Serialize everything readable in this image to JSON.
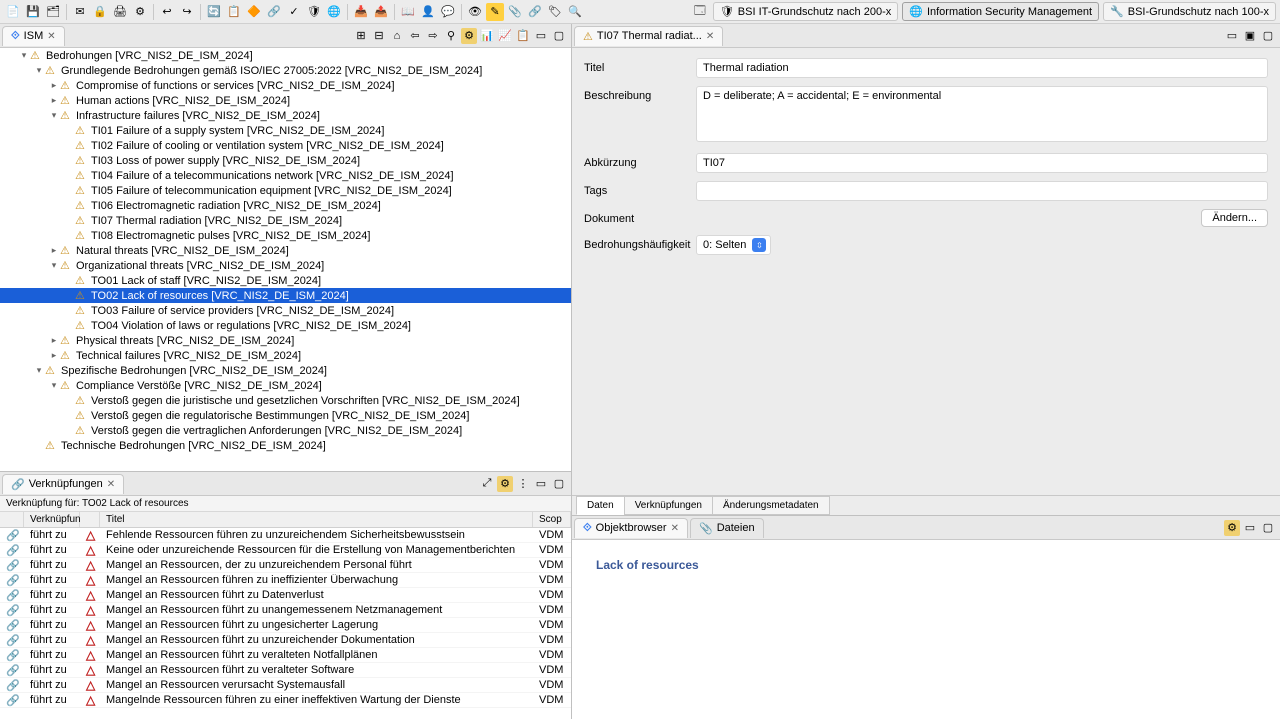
{
  "toolbar": {
    "perspectives": [
      {
        "label": "BSI IT-Grundschutz nach 200-x",
        "shield": "🛡"
      },
      {
        "label": "Information Security Management",
        "icon": "🌐",
        "active": true
      },
      {
        "label": "BSI-Grundschutz nach 100-x",
        "icon": "🔧"
      }
    ]
  },
  "left_tab": {
    "label": "ISM"
  },
  "tree": [
    {
      "level": 0,
      "toggle": "▾",
      "label": "Bedrohungen [VRC_NIS2_DE_ISM_2024]"
    },
    {
      "level": 1,
      "toggle": "▾",
      "label": "Grundlegende Bedrohungen gemäß ISO/IEC 27005:2022 [VRC_NIS2_DE_ISM_2024]"
    },
    {
      "level": 2,
      "toggle": "▸",
      "label": "Compromise of functions or services [VRC_NIS2_DE_ISM_2024]"
    },
    {
      "level": 2,
      "toggle": "▸",
      "label": "Human actions [VRC_NIS2_DE_ISM_2024]"
    },
    {
      "level": 2,
      "toggle": "▾",
      "label": "Infrastructure failures [VRC_NIS2_DE_ISM_2024]"
    },
    {
      "level": 3,
      "toggle": "",
      "label": "TI01 Failure of a supply system [VRC_NIS2_DE_ISM_2024]"
    },
    {
      "level": 3,
      "toggle": "",
      "label": "TI02 Failure of cooling or ventilation system [VRC_NIS2_DE_ISM_2024]"
    },
    {
      "level": 3,
      "toggle": "",
      "label": "TI03 Loss of power supply [VRC_NIS2_DE_ISM_2024]"
    },
    {
      "level": 3,
      "toggle": "",
      "label": "TI04 Failure of a telecommunications network [VRC_NIS2_DE_ISM_2024]"
    },
    {
      "level": 3,
      "toggle": "",
      "label": "TI05 Failure of telecommunication equipment [VRC_NIS2_DE_ISM_2024]"
    },
    {
      "level": 3,
      "toggle": "",
      "label": "TI06 Electromagnetic radiation [VRC_NIS2_DE_ISM_2024]"
    },
    {
      "level": 3,
      "toggle": "",
      "label": "TI07 Thermal radiation [VRC_NIS2_DE_ISM_2024]"
    },
    {
      "level": 3,
      "toggle": "",
      "label": "TI08 Electromagnetic pulses [VRC_NIS2_DE_ISM_2024]"
    },
    {
      "level": 2,
      "toggle": "▸",
      "label": "Natural threats [VRC_NIS2_DE_ISM_2024]"
    },
    {
      "level": 2,
      "toggle": "▾",
      "label": "Organizational threats [VRC_NIS2_DE_ISM_2024]"
    },
    {
      "level": 3,
      "toggle": "",
      "label": "TO01 Lack of staff [VRC_NIS2_DE_ISM_2024]"
    },
    {
      "level": 3,
      "toggle": "",
      "label": "TO02 Lack of resources [VRC_NIS2_DE_ISM_2024]",
      "selected": true
    },
    {
      "level": 3,
      "toggle": "",
      "label": "TO03 Failure of service providers [VRC_NIS2_DE_ISM_2024]"
    },
    {
      "level": 3,
      "toggle": "",
      "label": "TO04 Violation of laws or regulations [VRC_NIS2_DE_ISM_2024]"
    },
    {
      "level": 2,
      "toggle": "▸",
      "label": "Physical threats [VRC_NIS2_DE_ISM_2024]"
    },
    {
      "level": 2,
      "toggle": "▸",
      "label": "Technical failures [VRC_NIS2_DE_ISM_2024]"
    },
    {
      "level": 1,
      "toggle": "▾",
      "label": "Spezifische Bedrohungen [VRC_NIS2_DE_ISM_2024]"
    },
    {
      "level": 2,
      "toggle": "▾",
      "label": "Compliance Verstöße [VRC_NIS2_DE_ISM_2024]"
    },
    {
      "level": 3,
      "toggle": "",
      "label": "Verstoß gegen die juristische und gesetzlichen Vorschriften [VRC_NIS2_DE_ISM_2024]"
    },
    {
      "level": 3,
      "toggle": "",
      "label": "Verstoß gegen die regulatorische Bestimmungen [VRC_NIS2_DE_ISM_2024]"
    },
    {
      "level": 3,
      "toggle": "",
      "label": "Verstoß gegen die vertraglichen Anforderungen [VRC_NIS2_DE_ISM_2024]"
    },
    {
      "level": 1,
      "toggle": "",
      "label": "Technische Bedrohungen [VRC_NIS2_DE_ISM_2024]"
    }
  ],
  "links_view": {
    "tab_label": "Verknüpfungen",
    "header": "Verknüpfung für: TO02 Lack of resources",
    "columns": {
      "relation": "Verknüpfun",
      "title": "Titel",
      "scope": "Scop"
    },
    "rows": [
      {
        "rel": "führt zu",
        "title": "Fehlende Ressourcen führen zu unzureichendem Sicherheitsbewusstsein",
        "scope": "VDM"
      },
      {
        "rel": "führt zu",
        "title": "Keine oder unzureichende Ressourcen für die Erstellung von Managementberichten",
        "scope": "VDM"
      },
      {
        "rel": "führt zu",
        "title": "Mangel an Ressourcen, der zu unzureichendem Personal führt",
        "scope": "VDM"
      },
      {
        "rel": "führt zu",
        "title": "Mangel an Ressourcen führen zu ineffizienter Überwachung",
        "scope": "VDM"
      },
      {
        "rel": "führt zu",
        "title": "Mangel an Ressourcen führt zu Datenverlust",
        "scope": "VDM"
      },
      {
        "rel": "führt zu",
        "title": "Mangel an Ressourcen führt zu unangemessenem Netzmanagement",
        "scope": "VDM"
      },
      {
        "rel": "führt zu",
        "title": "Mangel an Ressourcen führt zu ungesicherter Lagerung",
        "scope": "VDM"
      },
      {
        "rel": "führt zu",
        "title": "Mangel an Ressourcen führt zu unzureichender Dokumentation",
        "scope": "VDM"
      },
      {
        "rel": "führt zu",
        "title": "Mangel an Ressourcen führt zu veralteten Notfallplänen",
        "scope": "VDM"
      },
      {
        "rel": "führt zu",
        "title": "Mangel an Ressourcen führt zu veralteter Software",
        "scope": "VDM"
      },
      {
        "rel": "führt zu",
        "title": "Mangel an Ressourcen verursacht Systemausfall",
        "scope": "VDM"
      },
      {
        "rel": "führt zu",
        "title": "Mangelnde Ressourcen führen zu einer ineffektiven Wartung der Dienste",
        "scope": "VDM"
      }
    ]
  },
  "editor": {
    "tab_label": "TI07 Thermal radiat...",
    "fields": {
      "titel_label": "Titel",
      "titel_value": "Thermal radiation",
      "beschreibung_label": "Beschreibung",
      "beschreibung_value": "D = deliberate; A = accidental; E = environmental",
      "abkuerzung_label": "Abkürzung",
      "abkuerzung_value": "TI07",
      "tags_label": "Tags",
      "tags_value": "",
      "dokument_label": "Dokument",
      "aendern_label": "Ändern...",
      "haeufigkeit_label": "Bedrohungshäufigkeit",
      "haeufigkeit_value": "0: Selten"
    },
    "tabs": {
      "daten": "Daten",
      "verkn": "Verknüpfungen",
      "meta": "Änderungsmetadaten"
    }
  },
  "browser": {
    "tab1": "Objektbrowser",
    "tab2": "Dateien",
    "heading": "Lack of resources"
  }
}
